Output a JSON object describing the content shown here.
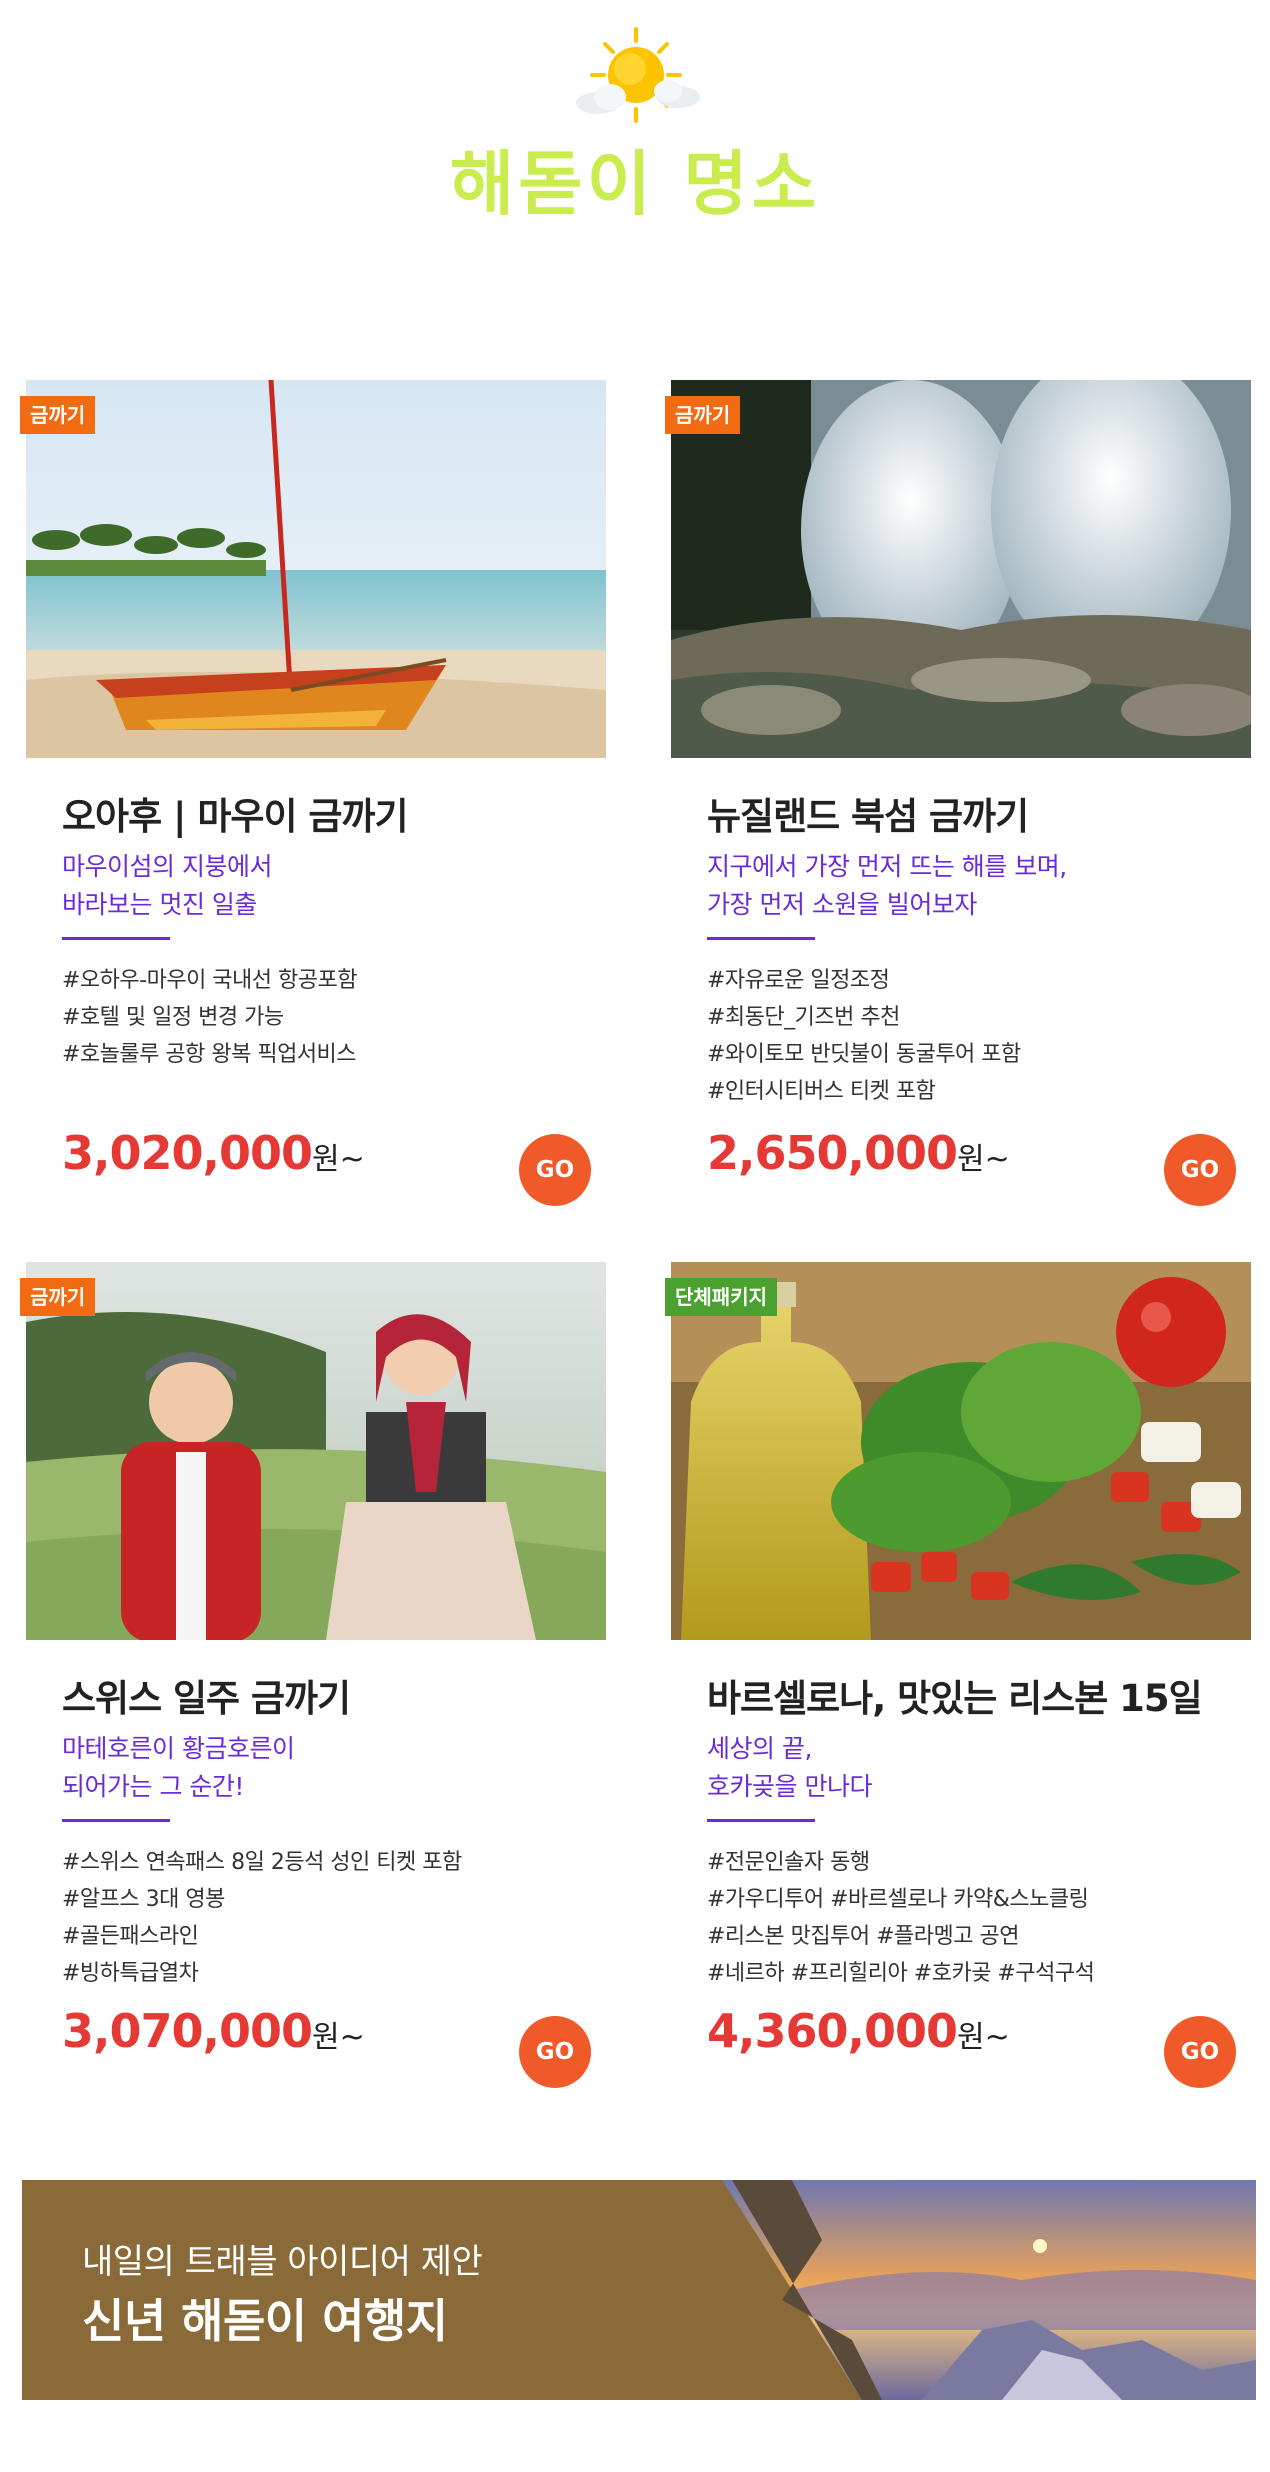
{
  "header": {
    "title": "해돋이 명소",
    "icon": "sun-cloud-icon"
  },
  "products": [
    {
      "badge": "금까기",
      "badge_color": "#f26a12",
      "title": "오아후 | 마우이 금까기",
      "subtitle": [
        "마우이섬의 지붕에서",
        "바라보는 멋진 일출"
      ],
      "tags": [
        "#오하우-마우이 국내선 항공포함",
        "#호텔 및 일정 변경 가능",
        "#호놀룰루 공항 왕복 픽업서비스"
      ],
      "price": "3,020,000",
      "price_unit": "원~",
      "go_label": "GO",
      "image": "catamaran-beach-photo"
    },
    {
      "badge": "금까기",
      "badge_color": "#f26a12",
      "title": "뉴질랜드 북섬 금까기",
      "subtitle": [
        "지구에서 가장 먼저 뜨는 해를 보며,",
        "가장 먼저 소원을 빌어보자"
      ],
      "tags": [
        "#자유로운 일정조정",
        "#최동단_기즈번 추천",
        "#와이토모 반딧불이 동굴투어 포함",
        "#인터시티버스 티켓 포함"
      ],
      "price": "2,650,000",
      "price_unit": "원~",
      "go_label": "GO",
      "image": "geyser-photo"
    },
    {
      "badge": "금까기",
      "badge_color": "#f26a12",
      "title": "스위스 일주 금까기",
      "subtitle": [
        "마테호른이 황금호른이",
        "되어가는 그 순간!"
      ],
      "tags": [
        "#스위스 연속패스 8일 2등석 성인 티켓 포함",
        "#알프스 3대 영봉",
        "#골든패스라인",
        "#빙하특급열차"
      ],
      "price": "3,070,000",
      "price_unit": "원~",
      "go_label": "GO",
      "image": "swiss-children-photo"
    },
    {
      "badge": "단체패키지",
      "badge_color": "#4aa12f",
      "title": "바르셀로나, 맛있는 리스본 15일",
      "subtitle": [
        "세상의 끝,",
        "호카곶을 만나다"
      ],
      "tags": [
        "#전문인솔자 동행",
        "#가우디투어 #바르셀로나 카약&스노클링",
        "#리스본 맛집투어 #플라멩고 공연",
        "#네르하 #프리힐리아 #호카곶 #구석구석"
      ],
      "price": "4,360,000",
      "price_unit": "원~",
      "go_label": "GO",
      "image": "olive-oil-tomato-photo"
    }
  ],
  "banner": {
    "kicker": "내일의 트래블 아이디어 제안",
    "title": "신년 해돋이 여행지",
    "bg_color": "#8a6a38",
    "image": "mountain-sunrise-photo"
  }
}
